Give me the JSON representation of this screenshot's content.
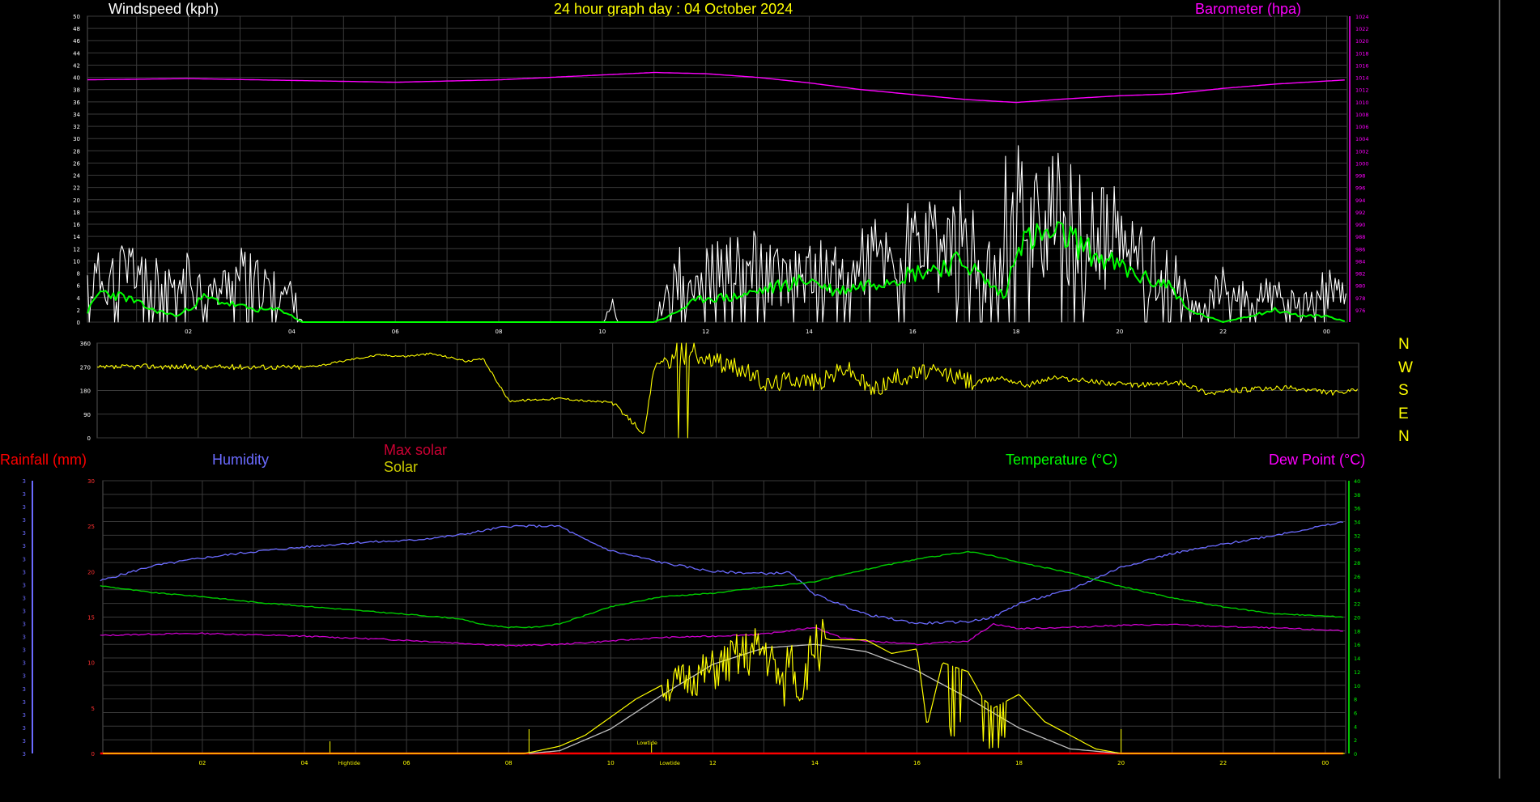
{
  "header": {
    "left_title": "Windspeed (kph)",
    "center_title": "24 hour graph day : 04 October 2024",
    "right_title": "Barometer (hpa)"
  },
  "bottom_labels": {
    "rainfall": "Rainfall (mm)",
    "humidity": "Humidity",
    "max_solar": "Max solar",
    "solar": "Solar",
    "temperature": "Temperature (°C)",
    "dew_point": "Dew Point (°C)",
    "hightide": "Hightide",
    "lowtide_top": "Lowtide",
    "lowtide_bottom": "Lowtide"
  },
  "direction_scale": [
    "N",
    "W",
    "S",
    "E",
    "N"
  ],
  "colors": {
    "background": "#000000",
    "grid": "#3a3a3a",
    "windspeed": "#ffffff",
    "wind_avg": "#00ff00",
    "barometer": "#ff00ff",
    "wind_direction": "#ffff00",
    "rainfall": "#ff0000",
    "humidity": "#6b6bff",
    "max_solar": "#c0c0c0",
    "solar": "#ffff00",
    "temperature": "#00cc00",
    "dew_point": "#cc00cc"
  },
  "chart_data": [
    {
      "type": "line",
      "panel": "wind",
      "x_tick_labels": [
        "02",
        "04",
        "06",
        "08",
        "10",
        "12",
        "14",
        "16",
        "18",
        "20",
        "22",
        "00"
      ],
      "x_hours_of_ticks": [
        2,
        4,
        6,
        8,
        10,
        12,
        14,
        16,
        18,
        20,
        22,
        24
      ],
      "xlim_hours": [
        0.05,
        24.4
      ],
      "left_axis": {
        "label": "Windspeed (kph)",
        "ylim": [
          0,
          50
        ],
        "ticks": [
          0,
          2,
          4,
          6,
          8,
          10,
          12,
          14,
          16,
          18,
          20,
          22,
          24,
          26,
          28,
          30,
          32,
          34,
          36,
          38,
          40,
          42,
          44,
          46,
          48,
          50
        ]
      },
      "right_axis": {
        "label": "Barometer (hpa)",
        "ylim": [
          974,
          1024
        ],
        "ticks": [
          976,
          978,
          980,
          982,
          984,
          986,
          988,
          990,
          992,
          994,
          996,
          998,
          1000,
          1002,
          1004,
          1006,
          1008,
          1010,
          1012,
          1014,
          1016,
          1018,
          1020,
          1022,
          1024
        ]
      },
      "series": [
        {
          "name": "Barometer (hpa)",
          "axis": "right",
          "x": [
            0,
            2,
            4,
            6,
            8,
            10,
            11,
            12,
            13,
            14,
            15,
            16,
            17,
            18,
            19,
            20,
            21,
            22,
            23,
            24.4
          ],
          "values": [
            1013.6,
            1013.8,
            1013.5,
            1013.2,
            1013.6,
            1014.4,
            1014.8,
            1014.6,
            1014.0,
            1013.1,
            1012.0,
            1011.2,
            1010.4,
            1009.9,
            1010.5,
            1011.0,
            1011.3,
            1012.2,
            1012.9,
            1013.6
          ]
        },
        {
          "name": "",
          "role": "gust",
          "axis": "left",
          "x": [
            0,
            0.5,
            1,
            1.5,
            2,
            2.5,
            3,
            3.5,
            4,
            4.2,
            6,
            8,
            10,
            10.2,
            10.3,
            10.5,
            10.8,
            11,
            11.3,
            11.5,
            12,
            12.5,
            13,
            13.5,
            14,
            14.5,
            15,
            15.5,
            16,
            16.5,
            17,
            17.3,
            17.5,
            17.8,
            18,
            18.5,
            19,
            19.5,
            20,
            20.5,
            21,
            21.2,
            21.5,
            22,
            22.5,
            23,
            23.5,
            24,
            24.4
          ],
          "values": [
            8,
            10,
            12,
            7,
            9,
            6,
            10,
            7,
            6,
            0,
            0,
            0,
            0,
            3,
            0,
            0,
            0,
            0,
            7,
            10,
            10,
            11,
            12,
            9,
            10,
            11,
            13,
            14,
            16,
            15,
            18,
            12,
            10,
            22,
            24,
            22,
            21,
            18,
            17,
            12,
            11,
            6,
            3,
            7,
            5,
            6,
            3,
            7,
            5
          ]
        },
        {
          "name": "",
          "role": "average",
          "axis": "left",
          "x": [
            0,
            0.3,
            0.8,
            1.3,
            1.8,
            2.3,
            2.8,
            3.3,
            3.8,
            4.2,
            6,
            8,
            10,
            10.5,
            11,
            11.3,
            11.7,
            12,
            12.5,
            13,
            13.5,
            14,
            14.5,
            15,
            15.5,
            16,
            16.5,
            17,
            17.5,
            17.8,
            18,
            18.5,
            19,
            19.5,
            20,
            20.5,
            21,
            21.3,
            22,
            22.5,
            23,
            23.5,
            24,
            24.4
          ],
          "values": [
            1,
            5,
            4,
            2,
            1,
            4,
            3,
            2,
            2,
            0,
            0,
            0,
            0,
            0,
            0,
            1,
            3,
            4,
            4,
            5,
            6,
            7,
            5,
            6,
            7,
            8,
            9,
            10,
            6,
            4,
            13,
            14,
            14,
            11,
            9,
            7,
            6,
            2,
            0,
            1,
            2,
            1,
            1,
            0
          ]
        },
        {
          "name": "",
          "role": "wind-direction",
          "axis": "direction",
          "ylim": [
            0,
            360
          ],
          "y_ticks": [
            0,
            90,
            180,
            270,
            360
          ],
          "x": [
            0,
            1,
            2,
            3,
            4,
            4.5,
            5,
            5.5,
            6,
            6.5,
            7,
            7.2,
            7.5,
            8,
            9,
            9.5,
            10,
            10.2,
            10.5,
            10.6,
            10.8,
            11,
            11.3,
            11.5,
            12,
            12.5,
            13,
            13.5,
            14,
            14.5,
            15,
            15.5,
            16,
            16.5,
            17,
            17.5,
            18,
            18.5,
            19,
            20,
            21,
            21.5,
            22,
            23,
            24,
            24.4
          ],
          "values": [
            265,
            272,
            268,
            270,
            268,
            280,
            300,
            315,
            310,
            320,
            300,
            290,
            300,
            140,
            150,
            140,
            135,
            90,
            40,
            0,
            270,
            300,
            280,
            310,
            290,
            260,
            200,
            230,
            210,
            270,
            180,
            230,
            250,
            240,
            210,
            230,
            200,
            230,
            220,
            200,
            210,
            170,
            180,
            190,
            170,
            180
          ]
        }
      ]
    },
    {
      "type": "line",
      "panel": "weather",
      "x_tick_labels": [
        "02",
        "04",
        "06",
        "08",
        "10",
        "12",
        "14",
        "16",
        "18",
        "20",
        "22",
        "00"
      ],
      "x_hours_of_ticks": [
        2,
        4,
        6,
        8,
        10,
        12,
        14,
        16,
        18,
        20,
        22,
        24
      ],
      "xlim_hours": [
        0.05,
        24.4
      ],
      "left_axis": {
        "label": "Rainfall (mm)",
        "ylim": [
          0,
          30
        ],
        "ticks": [
          0,
          5,
          10,
          15,
          20,
          25,
          30
        ]
      },
      "far_left_axis_ticks": [
        "3",
        "3",
        "3",
        "3",
        "3",
        "3",
        "3",
        "3",
        "3",
        "3",
        "3",
        "3",
        "3",
        "3",
        "3",
        "3",
        "3",
        "3",
        "3",
        "3",
        "3",
        "3"
      ],
      "right_axis": {
        "label": "Temperature (°C)",
        "ylim": [
          0,
          40
        ],
        "ticks": [
          0,
          2,
          4,
          6,
          8,
          10,
          12,
          14,
          16,
          18,
          20,
          22,
          24,
          26,
          28,
          30,
          32,
          34,
          36,
          38,
          40
        ]
      },
      "series": [
        {
          "name": "Humidity",
          "axis": "left",
          "x": [
            0,
            1,
            2,
            3,
            4,
            5,
            6,
            7,
            8,
            8.5,
            9,
            9.5,
            10,
            11,
            12,
            13,
            13.5,
            14,
            15,
            16,
            17,
            17.5,
            18,
            19,
            20,
            21,
            22,
            23,
            24.4
          ],
          "values": [
            19,
            20.6,
            21.5,
            22.2,
            22.7,
            23.2,
            23.4,
            24,
            25,
            25,
            25,
            23.5,
            22.3,
            21,
            20,
            19.8,
            19.9,
            17.5,
            15.3,
            14.3,
            14.5,
            15,
            16.5,
            18,
            20.5,
            22,
            23,
            24,
            25.5
          ]
        },
        {
          "name": "Max solar",
          "axis": "left",
          "x": [
            8.4,
            9,
            10,
            11,
            12,
            13,
            14,
            15,
            16,
            17,
            18,
            19,
            20
          ],
          "values": [
            0,
            0.3,
            2.7,
            6.4,
            9.8,
            11.6,
            12.0,
            11.2,
            9.1,
            6.1,
            2.8,
            0.5,
            0
          ]
        },
        {
          "name": "Solar",
          "axis": "left",
          "x": [
            0,
            8.3,
            8.5,
            9,
            9.5,
            10,
            10.5,
            11,
            11.5,
            12,
            12.5,
            13,
            13.2,
            13.4,
            13.5,
            13.7,
            14,
            14.3,
            15,
            15.5,
            16,
            16.2,
            16.5,
            17,
            17.3,
            17.5,
            18,
            18.5,
            19,
            19.5,
            20,
            24.4
          ],
          "values": [
            0,
            0,
            0.2,
            0.8,
            2,
            4,
            6,
            7.5,
            8.5,
            9.5,
            11,
            12,
            10,
            7,
            12.5,
            6.5,
            13,
            12.5,
            12.5,
            11,
            11.5,
            3,
            10,
            9,
            6,
            5,
            6.5,
            3.5,
            2,
            0.5,
            0,
            0
          ]
        },
        {
          "name": "Rainfall (mm)",
          "axis": "left",
          "x": [
            0,
            24.4
          ],
          "values": [
            0,
            0
          ]
        },
        {
          "name": "Temperature (°C)",
          "axis": "right",
          "x": [
            0,
            1,
            2,
            3,
            4,
            5,
            6,
            7,
            7.5,
            8,
            8.5,
            9,
            10,
            11,
            12,
            13,
            14,
            15,
            16,
            17,
            17.5,
            18,
            19,
            20,
            21,
            22,
            23,
            24.4
          ],
          "values": [
            24.6,
            23.6,
            23.0,
            22.2,
            21.6,
            21.0,
            20.4,
            19.8,
            18.9,
            18.5,
            18.5,
            19.0,
            21.5,
            23.0,
            23.5,
            24.4,
            25.2,
            27.0,
            28.5,
            29.6,
            29.0,
            28.0,
            26.5,
            24.5,
            22.8,
            21.5,
            20.5,
            20.0
          ]
        },
        {
          "name": "Dew Point (°C)",
          "axis": "right",
          "x": [
            0,
            1,
            2,
            3,
            4,
            5,
            6,
            7,
            8,
            9,
            10,
            11,
            12,
            13,
            13.5,
            14,
            14.5,
            15,
            16,
            17,
            17.5,
            18,
            19,
            20,
            21,
            22,
            23,
            24.4
          ],
          "values": [
            17.3,
            17.5,
            17.6,
            17.4,
            17.2,
            16.9,
            16.6,
            16.2,
            15.8,
            16,
            16.5,
            17,
            17.2,
            17.5,
            18.0,
            18.5,
            17.0,
            16.5,
            16.0,
            16.5,
            19.0,
            18.3,
            18.5,
            18.8,
            18.9,
            18.6,
            18.4,
            18.0
          ]
        }
      ]
    }
  ]
}
